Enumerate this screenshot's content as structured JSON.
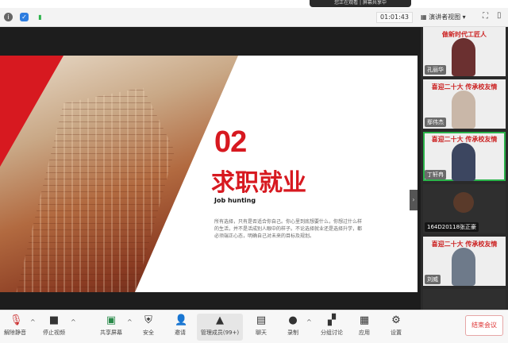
{
  "banner": "您正在观看 | 屏幕共享中",
  "topbar": {
    "timer": "01:01:43",
    "view_label": "演讲者视图"
  },
  "slide": {
    "number": "02",
    "title": "求职就业",
    "subtitle": "Job hunting",
    "body": "所有选择，只有是否适合你自己。你心里到底想要什么，你想过什么样的生活，并不是活成别人眼中的样子。不论选择就业还是选择升学，都必须端正心态，明确自己对未来的目标及规划。"
  },
  "participants": [
    {
      "name": "孔丽华",
      "banner": "做新时代工匠人"
    },
    {
      "name": "鄢伟杰",
      "banner": "喜迎二十大 传承校友情"
    },
    {
      "name": "丁轩冉",
      "banner": "喜迎二十大 传承校友情"
    },
    {
      "name": "164D20118张正豪",
      "banner": ""
    },
    {
      "name": "刘威",
      "banner": "喜迎二十大 传承校友情"
    }
  ],
  "toolbar": {
    "mute": "解除静音",
    "video": "停止视频",
    "share": "共享屏幕",
    "security": "安全",
    "invite": "邀请",
    "members": "管理成员(99+)",
    "chat": "聊天",
    "record": "录制",
    "breakout": "分组讨论",
    "apps": "应用",
    "settings": "设置",
    "end": "结束会议"
  },
  "colors": {
    "accent": "#d71920"
  }
}
